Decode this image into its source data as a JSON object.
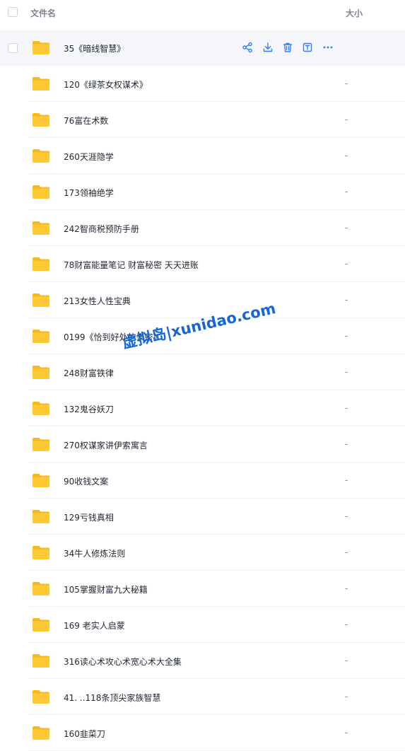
{
  "header": {
    "col_name": "文件名",
    "col_size": "大小"
  },
  "rows": [
    {
      "name": "35《暗线智慧》",
      "size": ""
    },
    {
      "name": "120《绿茶女权谋术》",
      "size": "-"
    },
    {
      "name": "76富在术数",
      "size": "-"
    },
    {
      "name": "260天涯隐学",
      "size": "-"
    },
    {
      "name": "173领袖绝学",
      "size": "-"
    },
    {
      "name": "242智商税预防手册",
      "size": "-"
    },
    {
      "name": "78财富能量笔记 财富秘密 天天进账",
      "size": "-"
    },
    {
      "name": "213女性人性宝典",
      "size": "-"
    },
    {
      "name": "0199《恰到好处的亲密》",
      "size": "-"
    },
    {
      "name": "248财富铁律",
      "size": "-"
    },
    {
      "name": "132鬼谷妖刀",
      "size": "-"
    },
    {
      "name": "270权谋家讲伊索寓言",
      "size": "-"
    },
    {
      "name": "90收钱文案",
      "size": "-"
    },
    {
      "name": "129亏钱真相",
      "size": "-"
    },
    {
      "name": "34牛人修炼法则",
      "size": "-"
    },
    {
      "name": "105掌握财富九大秘籍",
      "size": "-"
    },
    {
      "name": "169 老实人启蒙",
      "size": "-"
    },
    {
      "name": "316读心术攻心术宽心术大全集",
      "size": "-"
    },
    {
      "name": "41. ..118条顶尖家族智慧",
      "size": "-"
    },
    {
      "name": "160韭菜刀",
      "size": "-"
    }
  ],
  "hover_actions": [
    "share-icon",
    "download-icon",
    "trash-icon",
    "rename-icon",
    "more-icon"
  ],
  "watermark": "虚拟岛|xunidao.com",
  "colors": {
    "folder": "#ffc933",
    "folder_back": "#f5b820",
    "action_icon": "#2f7ff7",
    "hover_row": "#f4f6fa",
    "watermark": "#1565d8"
  }
}
